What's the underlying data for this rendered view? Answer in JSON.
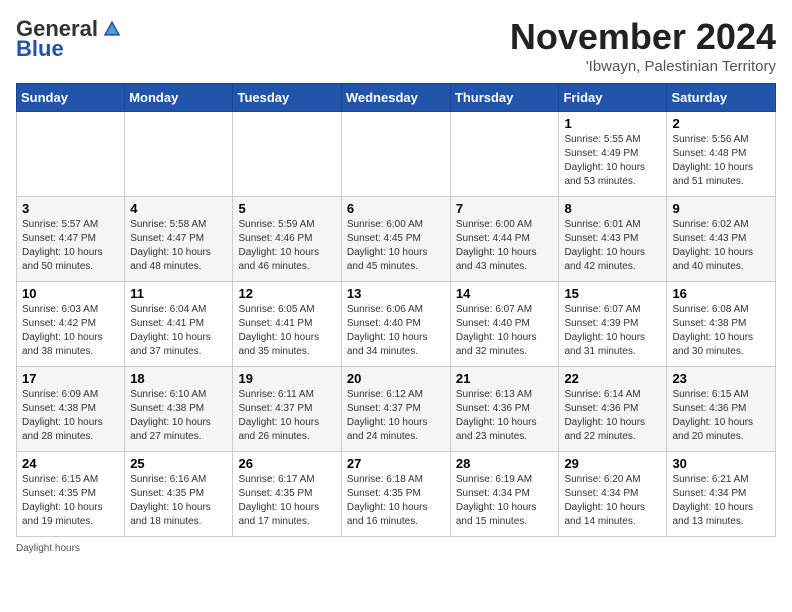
{
  "logo": {
    "general": "General",
    "blue": "Blue"
  },
  "title": "November 2024",
  "subtitle": "'Ibwayn, Palestinian Territory",
  "days_of_week": [
    "Sunday",
    "Monday",
    "Tuesday",
    "Wednesday",
    "Thursday",
    "Friday",
    "Saturday"
  ],
  "weeks": [
    [
      {
        "day": "",
        "info": ""
      },
      {
        "day": "",
        "info": ""
      },
      {
        "day": "",
        "info": ""
      },
      {
        "day": "",
        "info": ""
      },
      {
        "day": "",
        "info": ""
      },
      {
        "day": "1",
        "info": "Sunrise: 5:55 AM\nSunset: 4:49 PM\nDaylight: 10 hours and 53 minutes."
      },
      {
        "day": "2",
        "info": "Sunrise: 5:56 AM\nSunset: 4:48 PM\nDaylight: 10 hours and 51 minutes."
      }
    ],
    [
      {
        "day": "3",
        "info": "Sunrise: 5:57 AM\nSunset: 4:47 PM\nDaylight: 10 hours and 50 minutes."
      },
      {
        "day": "4",
        "info": "Sunrise: 5:58 AM\nSunset: 4:47 PM\nDaylight: 10 hours and 48 minutes."
      },
      {
        "day": "5",
        "info": "Sunrise: 5:59 AM\nSunset: 4:46 PM\nDaylight: 10 hours and 46 minutes."
      },
      {
        "day": "6",
        "info": "Sunrise: 6:00 AM\nSunset: 4:45 PM\nDaylight: 10 hours and 45 minutes."
      },
      {
        "day": "7",
        "info": "Sunrise: 6:00 AM\nSunset: 4:44 PM\nDaylight: 10 hours and 43 minutes."
      },
      {
        "day": "8",
        "info": "Sunrise: 6:01 AM\nSunset: 4:43 PM\nDaylight: 10 hours and 42 minutes."
      },
      {
        "day": "9",
        "info": "Sunrise: 6:02 AM\nSunset: 4:43 PM\nDaylight: 10 hours and 40 minutes."
      }
    ],
    [
      {
        "day": "10",
        "info": "Sunrise: 6:03 AM\nSunset: 4:42 PM\nDaylight: 10 hours and 38 minutes."
      },
      {
        "day": "11",
        "info": "Sunrise: 6:04 AM\nSunset: 4:41 PM\nDaylight: 10 hours and 37 minutes."
      },
      {
        "day": "12",
        "info": "Sunrise: 6:05 AM\nSunset: 4:41 PM\nDaylight: 10 hours and 35 minutes."
      },
      {
        "day": "13",
        "info": "Sunrise: 6:06 AM\nSunset: 4:40 PM\nDaylight: 10 hours and 34 minutes."
      },
      {
        "day": "14",
        "info": "Sunrise: 6:07 AM\nSunset: 4:40 PM\nDaylight: 10 hours and 32 minutes."
      },
      {
        "day": "15",
        "info": "Sunrise: 6:07 AM\nSunset: 4:39 PM\nDaylight: 10 hours and 31 minutes."
      },
      {
        "day": "16",
        "info": "Sunrise: 6:08 AM\nSunset: 4:38 PM\nDaylight: 10 hours and 30 minutes."
      }
    ],
    [
      {
        "day": "17",
        "info": "Sunrise: 6:09 AM\nSunset: 4:38 PM\nDaylight: 10 hours and 28 minutes."
      },
      {
        "day": "18",
        "info": "Sunrise: 6:10 AM\nSunset: 4:38 PM\nDaylight: 10 hours and 27 minutes."
      },
      {
        "day": "19",
        "info": "Sunrise: 6:11 AM\nSunset: 4:37 PM\nDaylight: 10 hours and 26 minutes."
      },
      {
        "day": "20",
        "info": "Sunrise: 6:12 AM\nSunset: 4:37 PM\nDaylight: 10 hours and 24 minutes."
      },
      {
        "day": "21",
        "info": "Sunrise: 6:13 AM\nSunset: 4:36 PM\nDaylight: 10 hours and 23 minutes."
      },
      {
        "day": "22",
        "info": "Sunrise: 6:14 AM\nSunset: 4:36 PM\nDaylight: 10 hours and 22 minutes."
      },
      {
        "day": "23",
        "info": "Sunrise: 6:15 AM\nSunset: 4:36 PM\nDaylight: 10 hours and 20 minutes."
      }
    ],
    [
      {
        "day": "24",
        "info": "Sunrise: 6:15 AM\nSunset: 4:35 PM\nDaylight: 10 hours and 19 minutes."
      },
      {
        "day": "25",
        "info": "Sunrise: 6:16 AM\nSunset: 4:35 PM\nDaylight: 10 hours and 18 minutes."
      },
      {
        "day": "26",
        "info": "Sunrise: 6:17 AM\nSunset: 4:35 PM\nDaylight: 10 hours and 17 minutes."
      },
      {
        "day": "27",
        "info": "Sunrise: 6:18 AM\nSunset: 4:35 PM\nDaylight: 10 hours and 16 minutes."
      },
      {
        "day": "28",
        "info": "Sunrise: 6:19 AM\nSunset: 4:34 PM\nDaylight: 10 hours and 15 minutes."
      },
      {
        "day": "29",
        "info": "Sunrise: 6:20 AM\nSunset: 4:34 PM\nDaylight: 10 hours and 14 minutes."
      },
      {
        "day": "30",
        "info": "Sunrise: 6:21 AM\nSunset: 4:34 PM\nDaylight: 10 hours and 13 minutes."
      }
    ]
  ],
  "daylight_note": "Daylight hours"
}
